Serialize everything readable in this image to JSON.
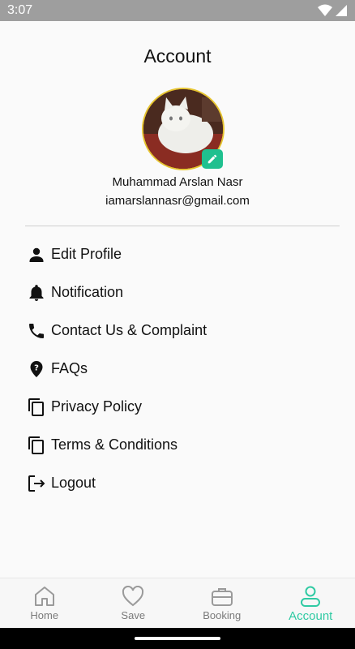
{
  "status_bar": {
    "time": "3:07",
    "icons": [
      "wifi-icon",
      "signal-icon"
    ]
  },
  "header": {
    "title": "Account"
  },
  "profile": {
    "avatar_icon": "cat-photo",
    "edit_icon": "pencil-icon",
    "name": "Muhammad Arslan Nasr",
    "email": "iamarslannasr@gmail.com",
    "accent_color": "#1fc08f"
  },
  "menu": {
    "items": [
      {
        "label": "Edit Profile",
        "icon": "person-icon"
      },
      {
        "label": "Notification",
        "icon": "bell-icon"
      },
      {
        "label": "Contact Us & Complaint",
        "icon": "phone-icon"
      },
      {
        "label": "FAQs",
        "icon": "help-pin-icon"
      },
      {
        "label": "Privacy Policy",
        "icon": "copy-icon"
      },
      {
        "label": "Terms & Conditions",
        "icon": "copy-icon"
      },
      {
        "label": "Logout",
        "icon": "logout-icon"
      }
    ]
  },
  "bottom_nav": {
    "items": [
      {
        "label": "Home",
        "icon": "home-icon"
      },
      {
        "label": "Save",
        "icon": "heart-icon"
      },
      {
        "label": "Booking",
        "icon": "briefcase-icon"
      },
      {
        "label": "Account",
        "icon": "account-icon"
      }
    ],
    "active": "Account",
    "active_color": "#2fcaa3",
    "inactive_color": "#7a7a7a"
  }
}
